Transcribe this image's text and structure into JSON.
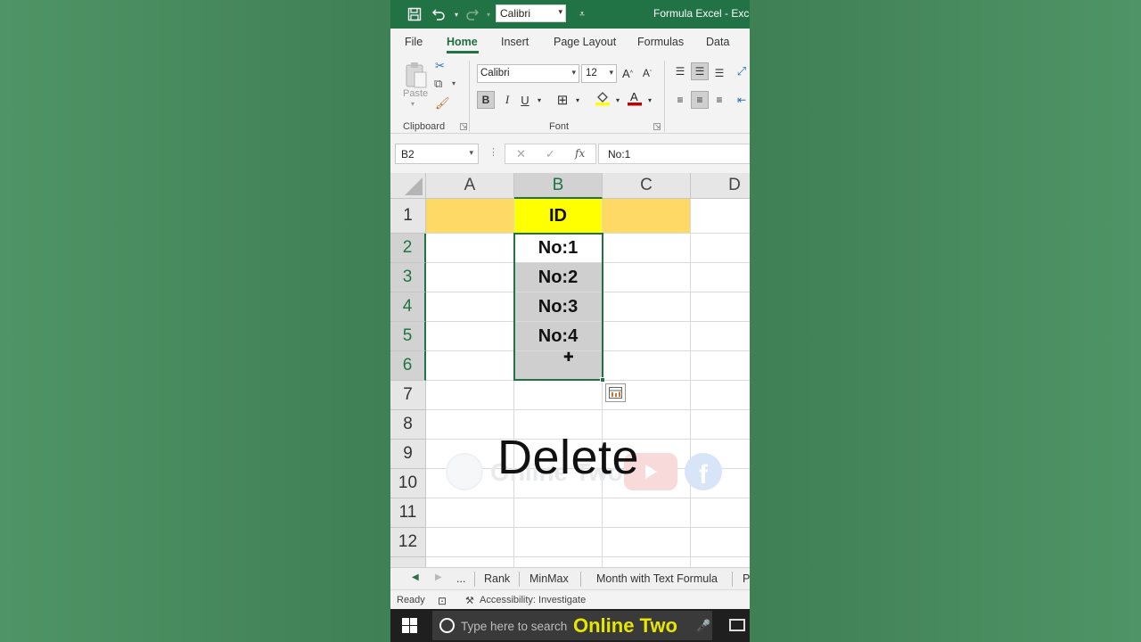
{
  "titlebar": {
    "quick_font": "Calibri",
    "title": "Formula Excel  -  Excel",
    "icons": [
      "save-icon",
      "undo-icon",
      "redo-icon",
      "customize-icon"
    ]
  },
  "ribbon_tabs": [
    "File",
    "Home",
    "Insert",
    "Page Layout",
    "Formulas",
    "Data"
  ],
  "ribbon": {
    "paste_label": "Paste",
    "clipboard_label": "Clipboard",
    "font_label": "Font",
    "font_name": "Calibri",
    "font_size": "12",
    "bold": "B",
    "italic": "I",
    "underline": "U"
  },
  "formula_bar": {
    "name_box": "B2",
    "cancel": "✕",
    "enter": "✓",
    "fx": "fx",
    "formula": "No:1"
  },
  "grid": {
    "columns": [
      "A",
      "B",
      "C",
      "D"
    ],
    "rows": [
      "1",
      "2",
      "3",
      "4",
      "5",
      "6",
      "7",
      "8",
      "9",
      "10",
      "11",
      "12"
    ],
    "cells": {
      "B1": "ID",
      "B2": "No:1",
      "B3": "No:2",
      "B4": "No:3",
      "B5": "No:4"
    }
  },
  "overlay": {
    "caption": "Delete",
    "watermark": "Online Two"
  },
  "sheet_tabs": [
    "...",
    "Rank",
    "MinMax",
    "Month with Text Formula",
    "P"
  ],
  "status": {
    "ready": "Ready",
    "accessibility": "Accessibility: Investigate"
  },
  "taskbar": {
    "search_placeholder": "Type here to search",
    "brand": "Online Two"
  },
  "colors": {
    "excel_green": "#217346",
    "header_orange": "#ffd966",
    "header_yellow": "#ffff00",
    "selection_gray": "#cfcfcf",
    "brand_yellow": "#e6e600"
  }
}
